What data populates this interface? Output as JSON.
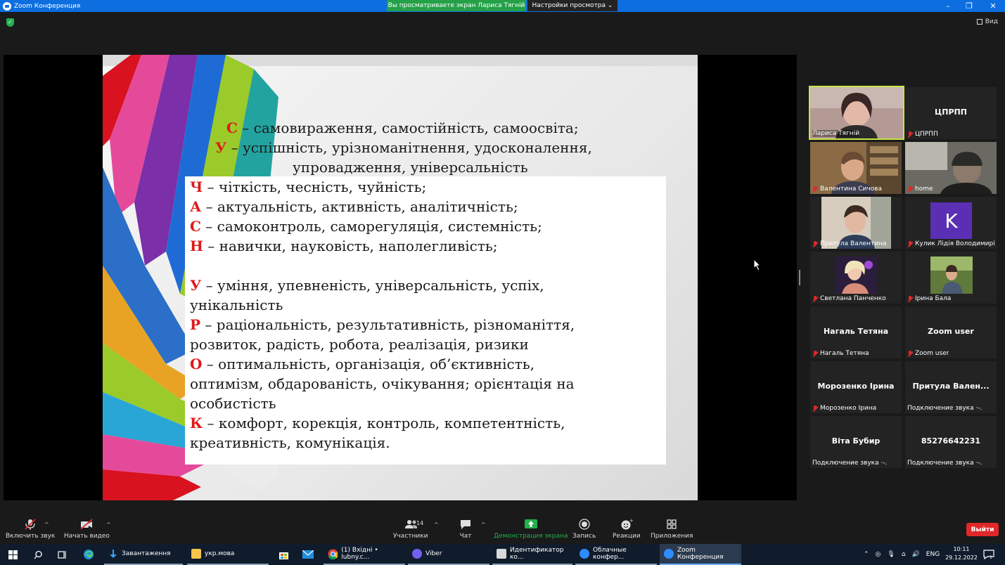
{
  "window": {
    "title": "Zoom Конференция",
    "share_banner": "Вы просматриваете экран Лариса Тягній",
    "view_options": "Настройки просмотра ⌄",
    "view_label": "Вид"
  },
  "slide": {
    "lines": [
      {
        "letter": "С",
        "text": " – самовираження, самостійність, самоосвіта;"
      },
      {
        "letter": "У",
        "text": " – успішність, урізноманітнення, удосконалення,"
      },
      {
        "letter": "",
        "text": "упровадження, універсальність"
      },
      {
        "letter": "Ч",
        "text": " – чіткість, чесність, чуйність;"
      },
      {
        "letter": "А",
        "text": " – актуальність, активність, аналітичність;"
      },
      {
        "letter": "С",
        "text": " – самоконтроль, саморегуляція, системність;"
      },
      {
        "letter": "Н",
        "text": " – навички, науковість, наполегливість;"
      },
      {
        "letter": "У",
        "text": " – уміння, упевненість, універсальність, успіх,"
      },
      {
        "letter": "",
        "text": "унікальність"
      },
      {
        "letter": "Р",
        "text": " – раціональність, результативність, різноманіття,"
      },
      {
        "letter": "",
        "text": "розвиток, радість, робота, реалізація, ризики"
      },
      {
        "letter": "О",
        "text": " – оптимальність, організація, об’єктивність,"
      },
      {
        "letter": "",
        "text": "оптимізм, обдарованість, очікування; орієнтація на"
      },
      {
        "letter": "",
        "text": "особистість"
      },
      {
        "letter": "К",
        "text": " – комфорт, корекція, контроль, компетентність,"
      },
      {
        "letter": "",
        "text": "креативність, комунікація."
      }
    ]
  },
  "participants": [
    {
      "tile_name": "",
      "label": "Лариса Тягній",
      "muted": false,
      "video": true
    },
    {
      "tile_name": "ЦПРПП",
      "label": "ЦПРПП",
      "muted": true,
      "video": false
    },
    {
      "tile_name": "",
      "label": "Валентина Сичова",
      "muted": true,
      "video": true
    },
    {
      "tile_name": "",
      "label": "home",
      "muted": true,
      "video": true
    },
    {
      "tile_name": "",
      "label": "Притула Валентина",
      "muted": true,
      "video": true
    },
    {
      "tile_name": "K",
      "label": "Кулик Лідія Володимирі...",
      "muted": true,
      "video": false
    },
    {
      "tile_name": "",
      "label": "Светлана Панченко",
      "muted": true,
      "video": true
    },
    {
      "tile_name": "",
      "label": "Ірина Бала",
      "muted": true,
      "video": true
    },
    {
      "tile_name": "Нагаль Тетяна",
      "label": "Нагаль Тетяна",
      "muted": true,
      "video": false
    },
    {
      "tile_name": "Zoom user",
      "label": "Zoom user",
      "muted": true,
      "video": false
    },
    {
      "tile_name": "Морозенко Ірина",
      "label": "Морозенко Ірина",
      "muted": true,
      "video": false
    },
    {
      "tile_name": "Притула  Вален...",
      "label": "Подключение звука ·-.",
      "muted": false,
      "video": false
    },
    {
      "tile_name": "Віта Бубир",
      "label": "Подключение звука ·-.",
      "muted": false,
      "video": false
    },
    {
      "tile_name": "85276642231",
      "label": "Подключение звука ·-.",
      "muted": false,
      "video": false
    }
  ],
  "toolbar": {
    "unmute": "Включить звук",
    "start_video": "Начать видео",
    "participants": "Участники",
    "participants_count": "14",
    "chat": "Чат",
    "share": "Демонстрация экрана",
    "record": "Запись",
    "reactions": "Реакции",
    "apps": "Приложения",
    "leave": "Выйти"
  },
  "taskbar": {
    "apps": [
      {
        "label": "Завантаження"
      },
      {
        "label": "укр.мова"
      },
      {
        "label": "(1) Вхідні • lubny.c..."
      },
      {
        "label": "Viber"
      },
      {
        "label": "Идентификатор ко..."
      },
      {
        "label": "Облачные конфер..."
      },
      {
        "label": "Zoom Конференция"
      }
    ],
    "lang": "ENG",
    "time": "10:11",
    "date": "29.12.2022"
  },
  "colors": {
    "title_bar": "#0d6ee0",
    "share_banner": "#24a148",
    "active_speaker": "#c8e646",
    "leave_button": "#e02828",
    "share_icon": "#23b14d",
    "accent_letter": "#e01818"
  }
}
